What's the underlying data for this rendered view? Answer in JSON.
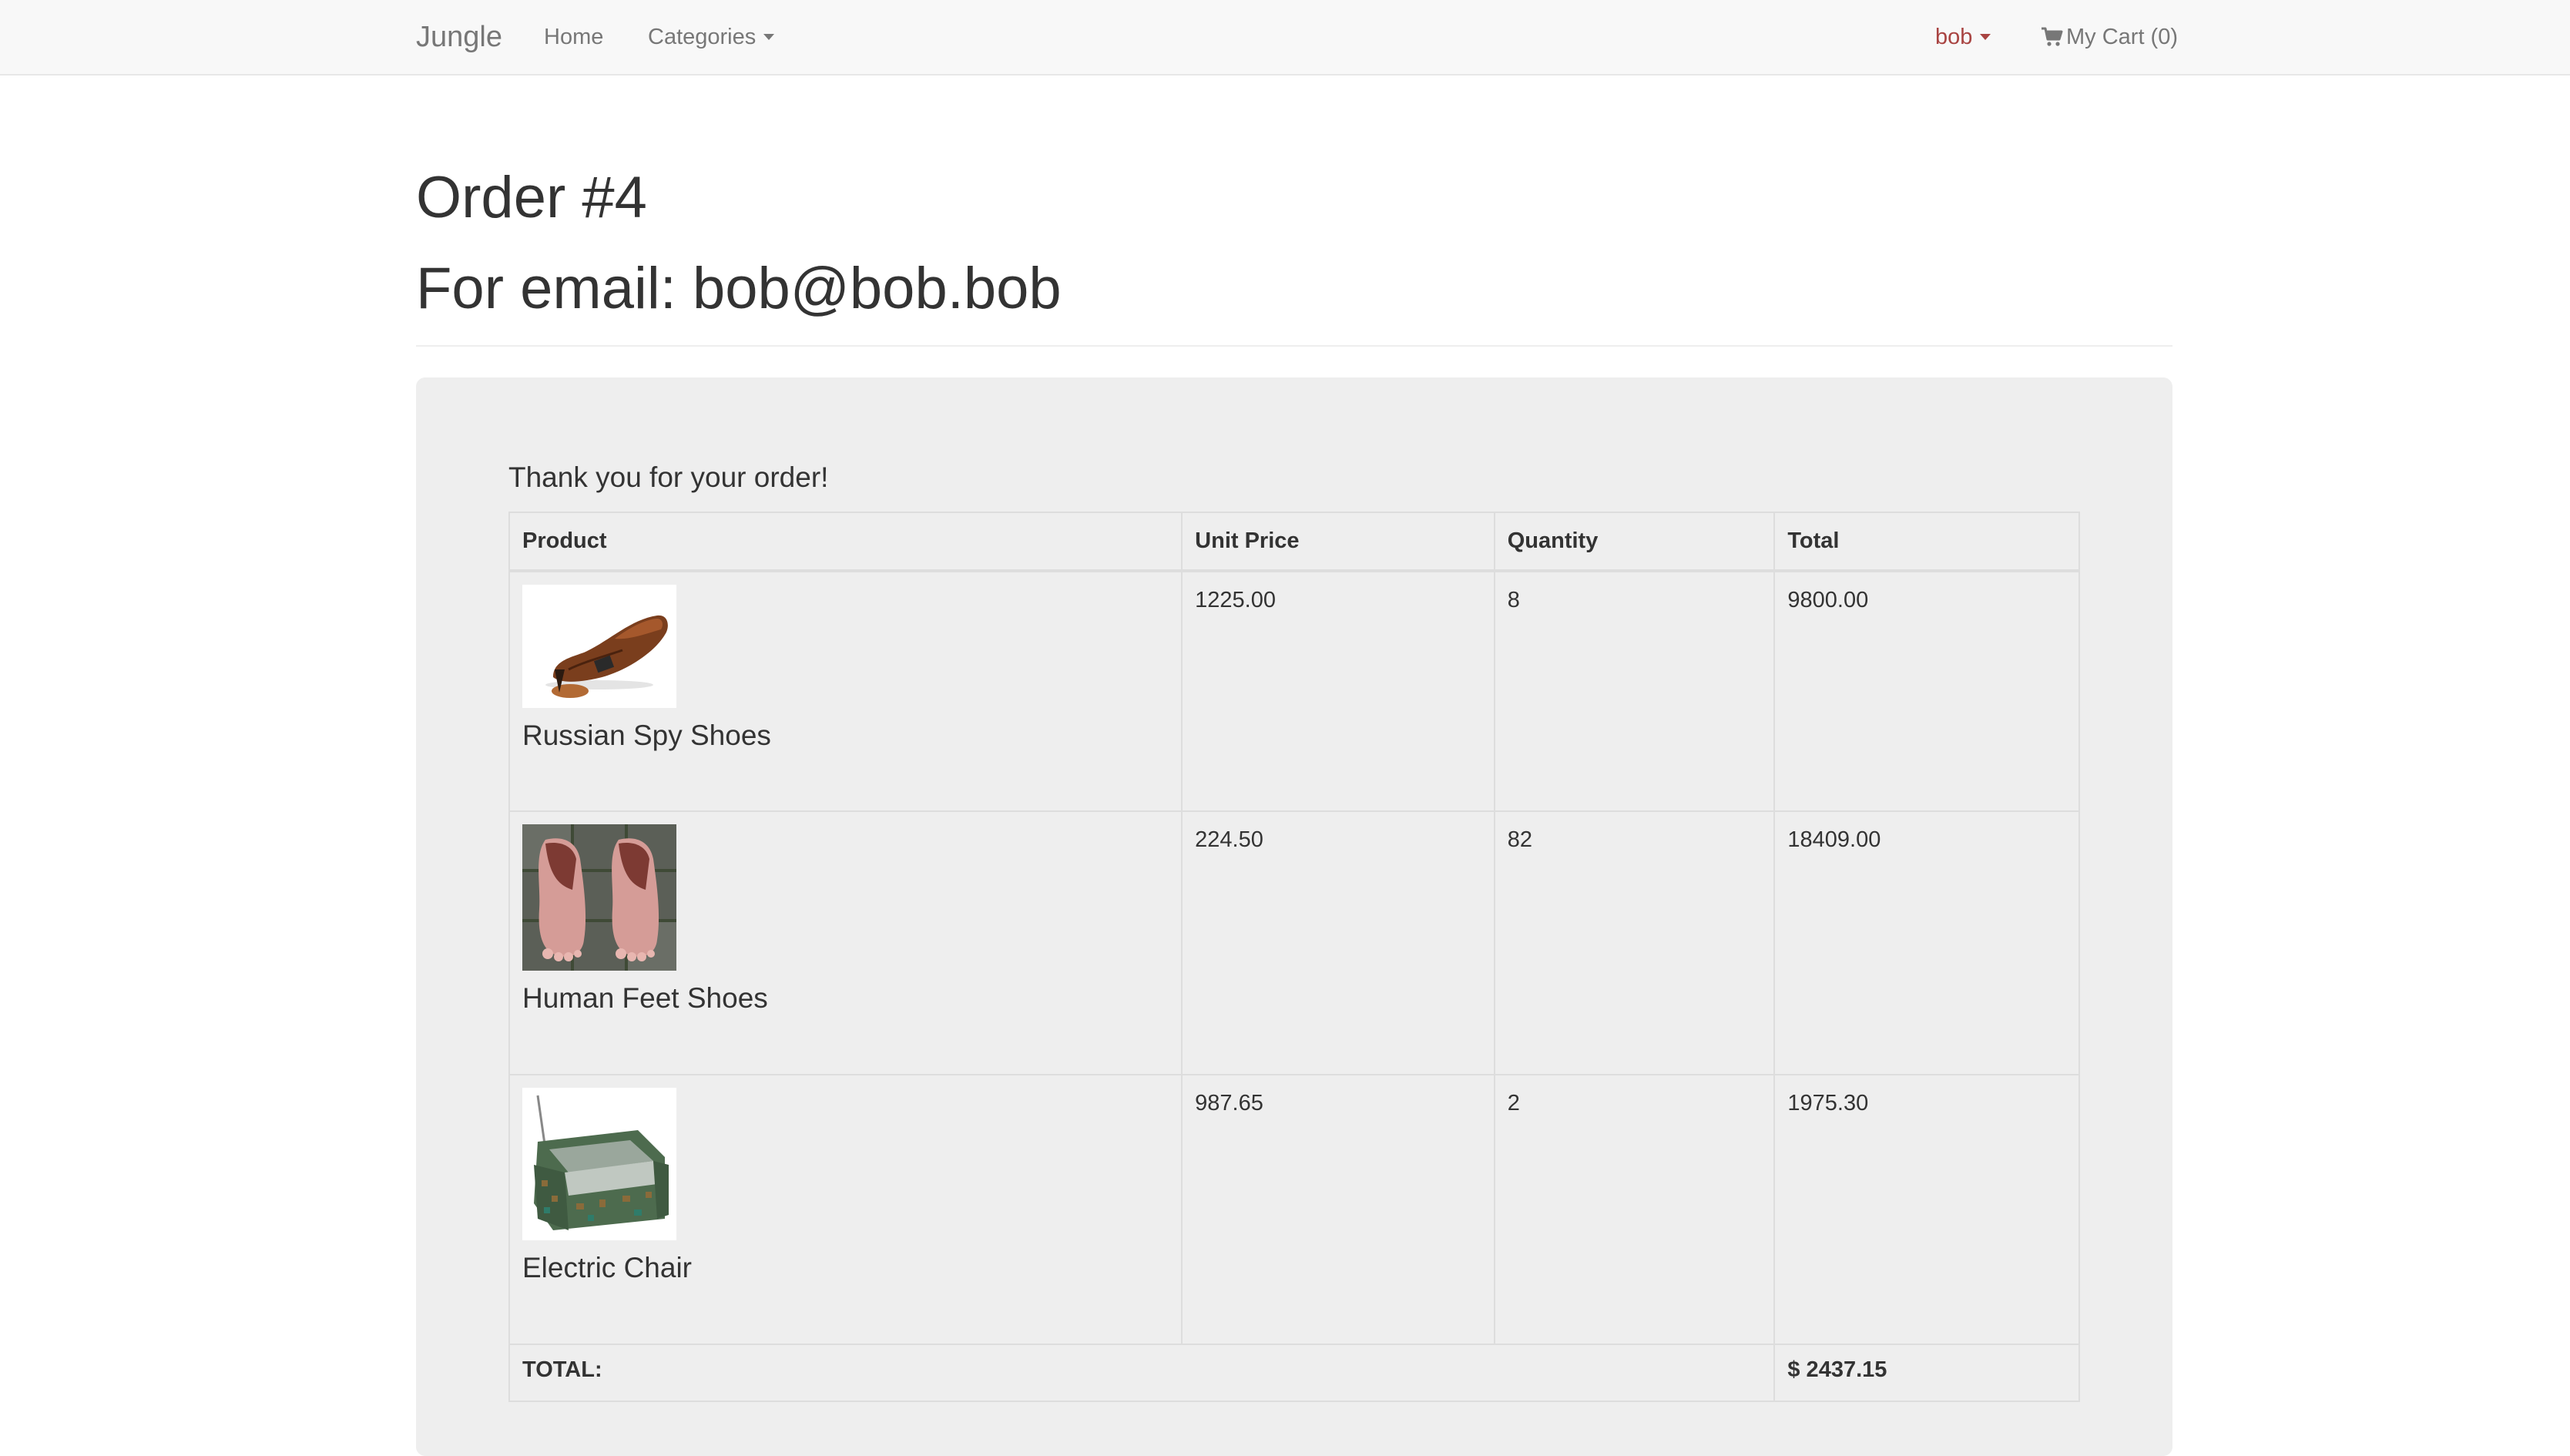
{
  "navbar": {
    "brand": "Jungle",
    "home": "Home",
    "categories": "Categories",
    "user": "bob",
    "cart": "My Cart (0)"
  },
  "header": {
    "order_title": "Order #4",
    "email_line": "For email: bob@bob.bob"
  },
  "order": {
    "thanks": "Thank you for your order!",
    "columns": {
      "product": "Product",
      "unit_price": "Unit Price",
      "quantity": "Quantity",
      "total": "Total"
    },
    "items": [
      {
        "name": "Russian Spy Shoes",
        "unit_price": "1225.00",
        "quantity": "8",
        "total": "9800.00",
        "image": "shoe-icon"
      },
      {
        "name": "Human Feet Shoes",
        "unit_price": "224.50",
        "quantity": "82",
        "total": "18409.00",
        "image": "feet-shoes-icon"
      },
      {
        "name": "Electric Chair",
        "unit_price": "987.65",
        "quantity": "2",
        "total": "1975.30",
        "image": "chair-icon"
      }
    ],
    "total_label": "TOTAL:",
    "grand_total": "$ 2437.15"
  },
  "colors": {
    "navbar_bg": "#f8f8f8",
    "panel_bg": "#eeeeee",
    "user_link": "#a94442",
    "text": "#333333"
  }
}
